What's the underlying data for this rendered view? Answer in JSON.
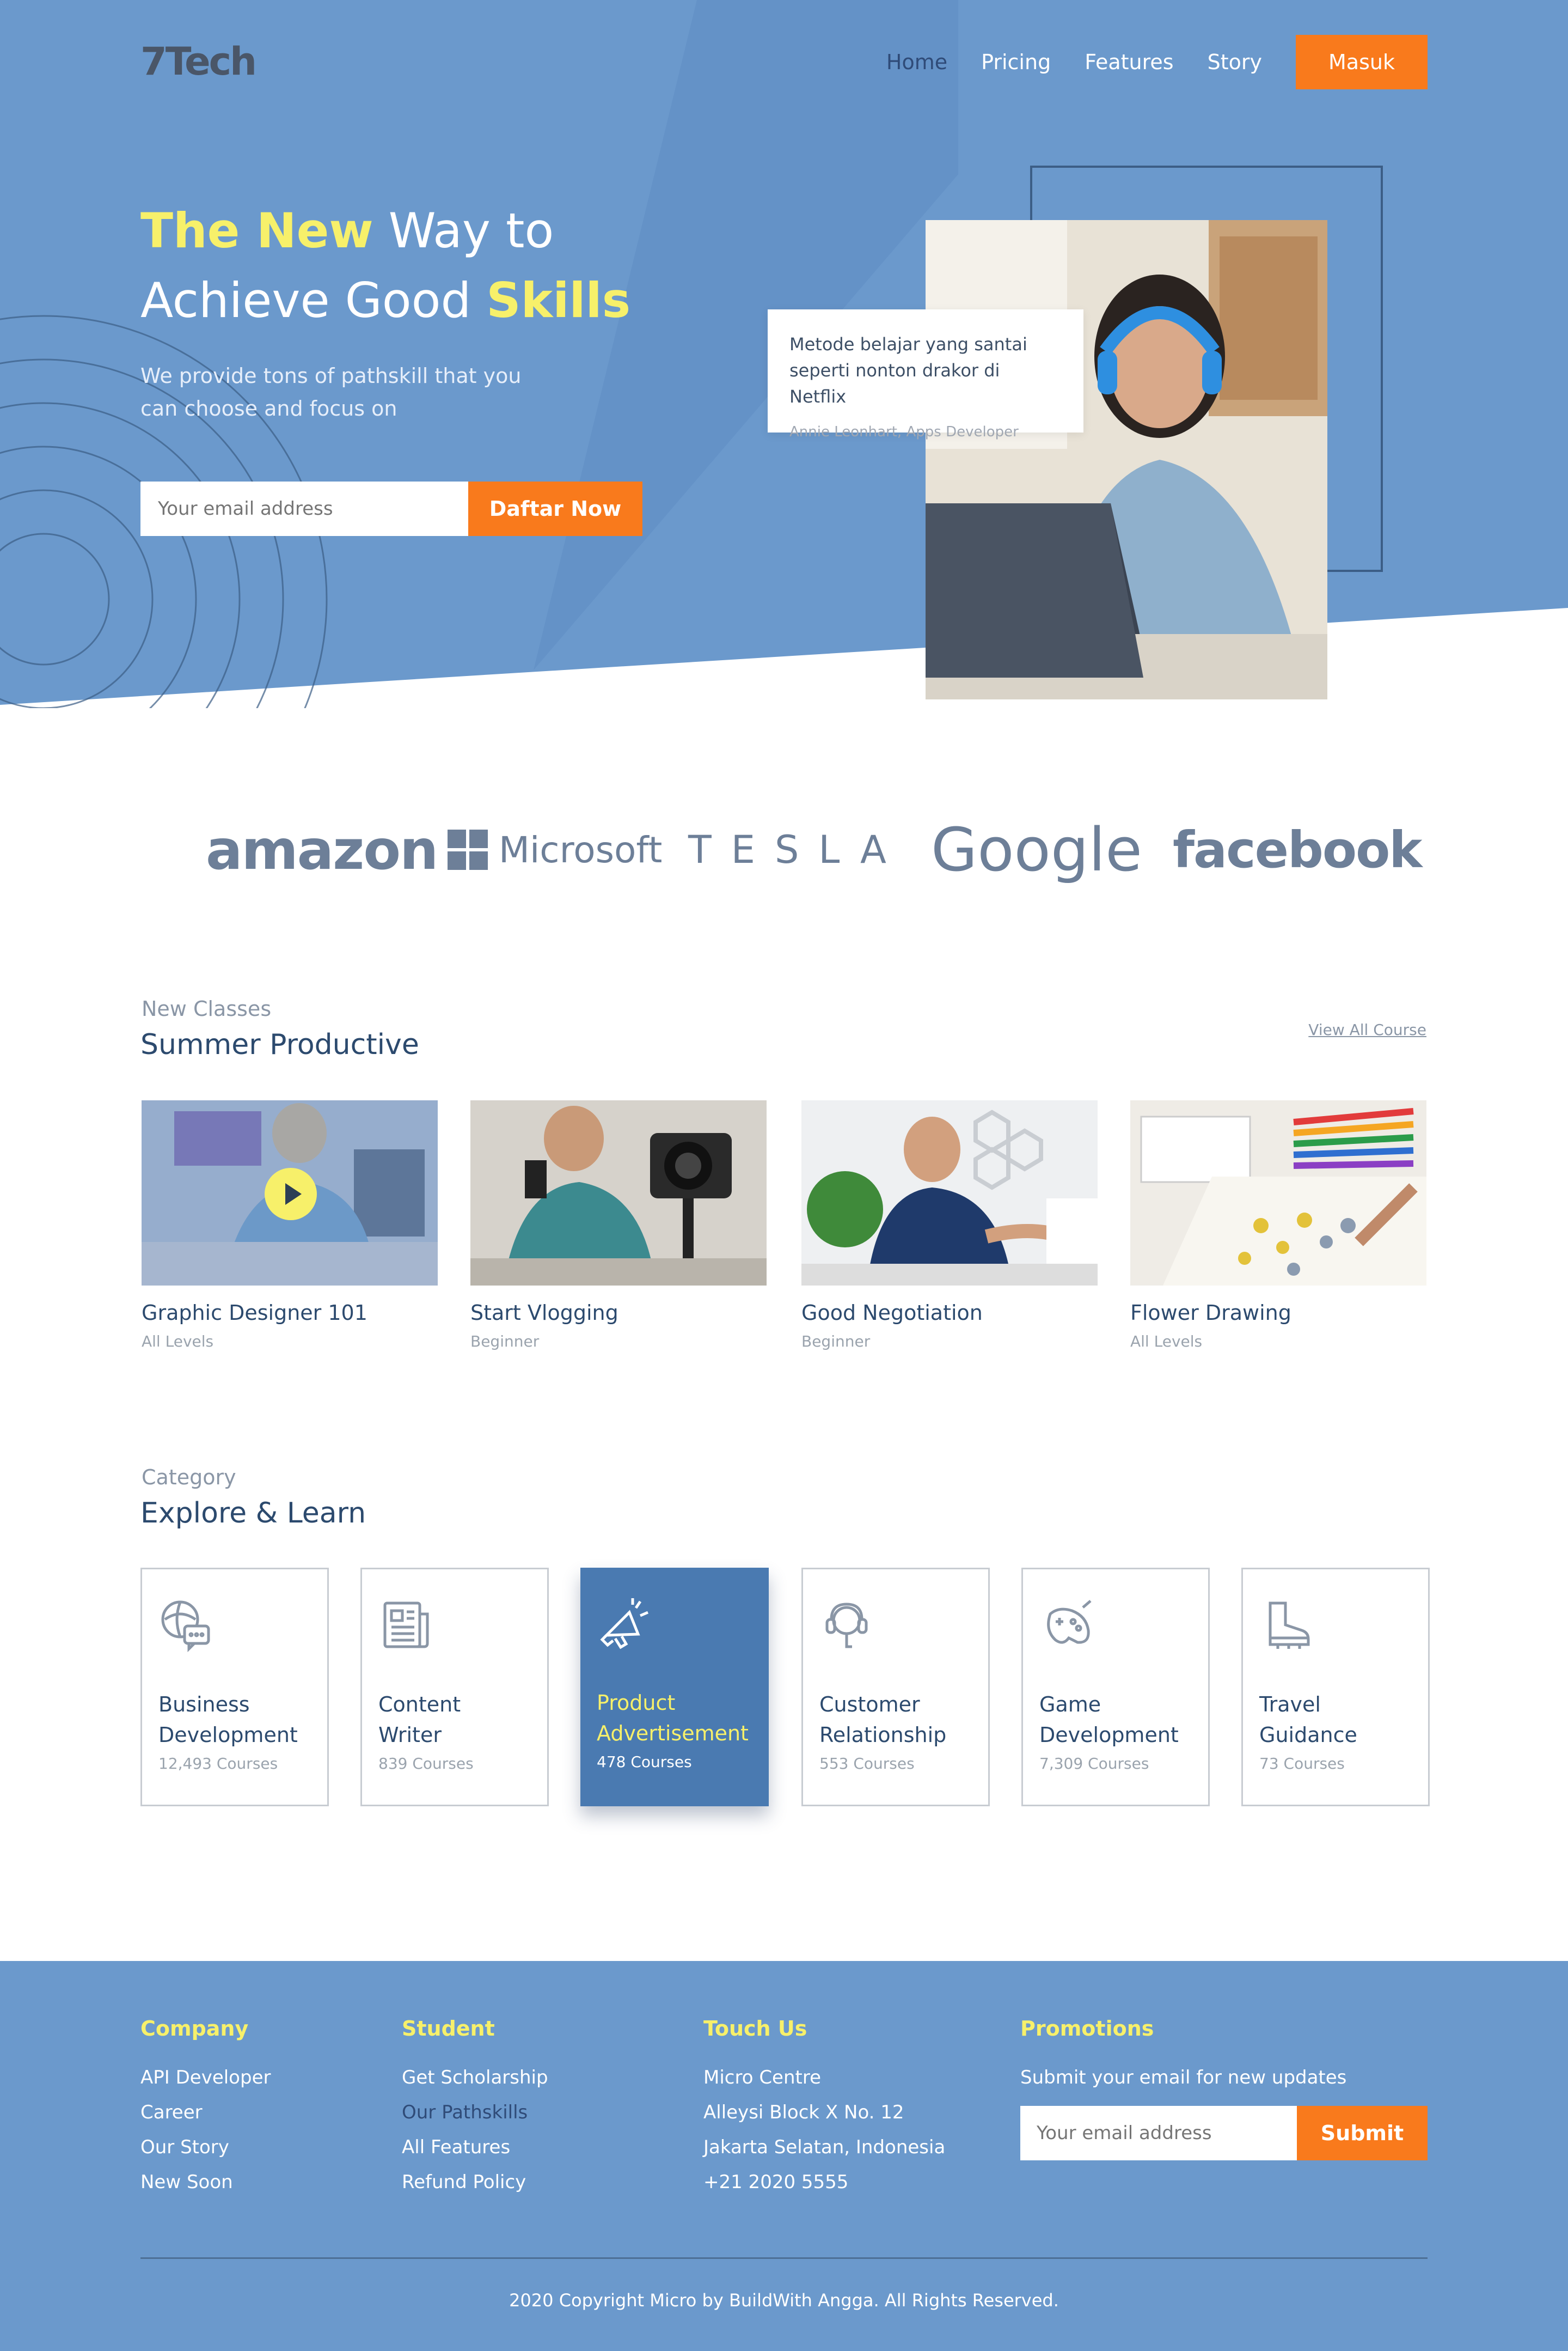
{
  "brand": {
    "logo": "7Tech"
  },
  "nav": {
    "items": [
      {
        "label": "Home"
      },
      {
        "label": "Pricing"
      },
      {
        "label": "Features"
      },
      {
        "label": "Story"
      }
    ],
    "cta": "Masuk"
  },
  "hero": {
    "title_y1": "The New",
    "title_w1": " Way to",
    "title_w2": "Achieve Good ",
    "title_y2": "Skills",
    "subtitle": "We provide tons of pathskill that you can choose and focus on",
    "email_placeholder": "Your email address",
    "cta": "Daftar Now",
    "quote": "Metode belajar yang santai seperti nonton drakor di Netflix",
    "quote_author": "Annie Leonhart, Apps Developer"
  },
  "brands": [
    "amazon",
    "Microsoft",
    "TESLA",
    "Google",
    "facebook"
  ],
  "classes": {
    "label": "New Classes",
    "title": "Summer Productive",
    "view_all": "View All Course",
    "items": [
      {
        "name": "Graphic Designer 101",
        "level": "All Levels"
      },
      {
        "name": "Start Vlogging",
        "level": "Beginner"
      },
      {
        "name": "Good Negotiation",
        "level": "Beginner"
      },
      {
        "name": "Flower Drawing",
        "level": "All Levels"
      }
    ]
  },
  "category": {
    "label": "Category",
    "title": "Explore & Learn",
    "items": [
      {
        "l1": "Business",
        "l2": "Development",
        "count": "12,493 Courses",
        "icon": "globe-chat-icon"
      },
      {
        "l1": "Content",
        "l2": "Writer",
        "count": "839 Courses",
        "icon": "newspaper-icon"
      },
      {
        "l1": "Product",
        "l2": "Advertisement",
        "count": "478 Courses",
        "icon": "megaphone-icon"
      },
      {
        "l1": "Customer",
        "l2": "Relationship",
        "count": "553 Courses",
        "icon": "headset-icon"
      },
      {
        "l1": "Game",
        "l2": "Development",
        "count": "7,309 Courses",
        "icon": "gamepad-icon"
      },
      {
        "l1": "Travel",
        "l2": "Guidance",
        "count": "73 Courses",
        "icon": "boot-icon"
      }
    ]
  },
  "footer": {
    "company": {
      "title": "Company",
      "links": [
        "API Developer",
        "Career",
        "Our Story",
        "New Soon"
      ]
    },
    "student": {
      "title": "Student",
      "links": [
        "Get Scholarship",
        "Our Pathskills",
        "All Features",
        "Refund Policy"
      ]
    },
    "touch": {
      "title": "Touch Us",
      "lines": [
        "Micro Centre",
        "Alleysi Block X No. 12",
        "Jakarta Selatan, Indonesia",
        "+21 2020 5555"
      ]
    },
    "promo": {
      "title": "Promotions",
      "text": "Submit your email for new updates",
      "placeholder": "Your email address",
      "cta": "Submit"
    },
    "copyright": "2020 Copyright Micro by BuildWith Angga. All Rights Reserved."
  },
  "colors": {
    "primary": "#6b99cc",
    "accent": "#f97a1c",
    "highlight": "#f7f06a",
    "text": "#2c4a6e"
  }
}
